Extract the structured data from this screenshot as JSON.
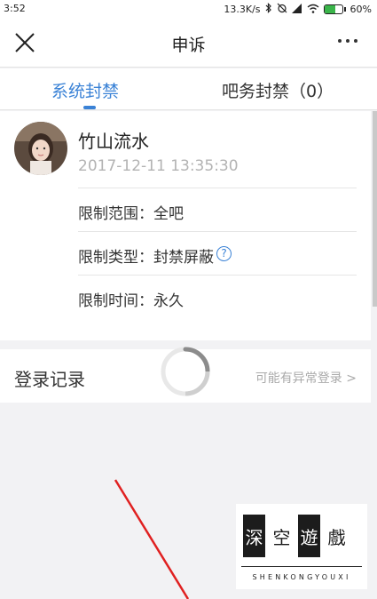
{
  "status_bar": {
    "time": "3:52",
    "network_speed": "13.3K/s",
    "battery_percent": "60%",
    "battery_level": 0.6,
    "icons": [
      "bluetooth-icon",
      "alarm-off-icon",
      "signal-icon",
      "wifi-icon",
      "battery-icon"
    ]
  },
  "nav": {
    "title": "申诉",
    "close_icon": "close-icon",
    "more_icon": "more-dots-icon"
  },
  "tabs": [
    {
      "label": "系统封禁",
      "active": true
    },
    {
      "label": "吧务封禁（0）",
      "active": false
    }
  ],
  "ban_card": {
    "user_name": "竹山流水",
    "timestamp": "2017-12-11 13:35:30",
    "rows": [
      {
        "label": "限制范围：全吧"
      },
      {
        "label": "限制类型：封禁屏蔽"
      },
      {
        "label": "限制时间：永久"
      }
    ],
    "help_icon_glyph": "?"
  },
  "login_record": {
    "label": "登录记录",
    "link": "可能有异常登录 >"
  },
  "watermark": {
    "chars": [
      "深",
      "空",
      "遊",
      "戲"
    ],
    "text": "SHENKONGYOUXI"
  },
  "colors": {
    "accent": "#3a82d6",
    "annotation_arrow": "#e02020",
    "background": "#f2f2f4"
  }
}
